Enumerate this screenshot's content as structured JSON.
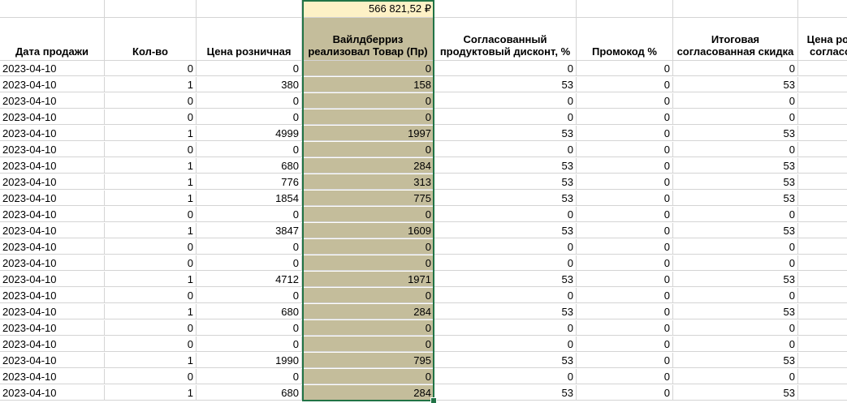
{
  "summary": {
    "total": "566 821,52 ₽"
  },
  "headers": [
    "Дата продажи",
    "Кол-во",
    "Цена розничная",
    "Вайлдберриз реализовал Товар (Пр)",
    "Согласованный продуктовый дисконт, %",
    "Промокод %",
    "Итоговая согласованная скидка",
    "Цена розничная с учетом согласованной скидки"
  ],
  "header_lines": [
    [
      "Дата продажи"
    ],
    [
      "Кол-во"
    ],
    [
      "Цена розничная"
    ],
    [
      "Вайлдберриз",
      "реализовал Товар (Пр)"
    ],
    [
      "Согласованный",
      "продуктовый дисконт, %"
    ],
    [
      "Промокод %"
    ],
    [
      "Итоговая",
      "согласованная скидка"
    ],
    [
      "Цена роз",
      "согласо"
    ]
  ],
  "rows": [
    [
      "2023-04-10",
      "0",
      "0",
      "0",
      "0",
      "0",
      "0",
      ""
    ],
    [
      "2023-04-10",
      "1",
      "380",
      "158",
      "53",
      "0",
      "53",
      ""
    ],
    [
      "2023-04-10",
      "0",
      "0",
      "0",
      "0",
      "0",
      "0",
      ""
    ],
    [
      "2023-04-10",
      "0",
      "0",
      "0",
      "0",
      "0",
      "0",
      ""
    ],
    [
      "2023-04-10",
      "1",
      "4999",
      "1997",
      "53",
      "0",
      "53",
      ""
    ],
    [
      "2023-04-10",
      "0",
      "0",
      "0",
      "0",
      "0",
      "0",
      ""
    ],
    [
      "2023-04-10",
      "1",
      "680",
      "284",
      "53",
      "0",
      "53",
      ""
    ],
    [
      "2023-04-10",
      "1",
      "776",
      "313",
      "53",
      "0",
      "53",
      ""
    ],
    [
      "2023-04-10",
      "1",
      "1854",
      "775",
      "53",
      "0",
      "53",
      ""
    ],
    [
      "2023-04-10",
      "0",
      "0",
      "0",
      "0",
      "0",
      "0",
      ""
    ],
    [
      "2023-04-10",
      "1",
      "3847",
      "1609",
      "53",
      "0",
      "53",
      ""
    ],
    [
      "2023-04-10",
      "0",
      "0",
      "0",
      "0",
      "0",
      "0",
      ""
    ],
    [
      "2023-04-10",
      "0",
      "0",
      "0",
      "0",
      "0",
      "0",
      ""
    ],
    [
      "2023-04-10",
      "1",
      "4712",
      "1971",
      "53",
      "0",
      "53",
      ""
    ],
    [
      "2023-04-10",
      "0",
      "0",
      "0",
      "0",
      "0",
      "0",
      ""
    ],
    [
      "2023-04-10",
      "1",
      "680",
      "284",
      "53",
      "0",
      "53",
      ""
    ],
    [
      "2023-04-10",
      "0",
      "0",
      "0",
      "0",
      "0",
      "0",
      ""
    ],
    [
      "2023-04-10",
      "0",
      "0",
      "0",
      "0",
      "0",
      "0",
      ""
    ],
    [
      "2023-04-10",
      "1",
      "1990",
      "795",
      "53",
      "0",
      "53",
      ""
    ],
    [
      "2023-04-10",
      "0",
      "0",
      "0",
      "0",
      "0",
      "0",
      ""
    ],
    [
      "2023-04-10",
      "1",
      "680",
      "284",
      "53",
      "0",
      "53",
      ""
    ]
  ],
  "colors": {
    "highlight_column": "#c4bd9b",
    "summary_fill": "#fdf1c6",
    "selection_border": "#217346",
    "gridline": "#d4d4d4"
  }
}
